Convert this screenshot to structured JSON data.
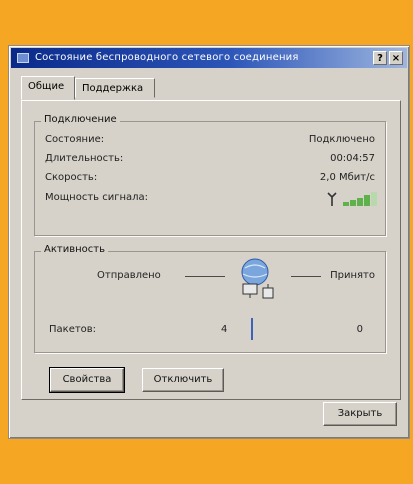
{
  "window": {
    "title": "Состояние беспроводного сетевого соединения",
    "help_label": "?",
    "close_label": "×"
  },
  "tabs": [
    {
      "label": "Общие"
    },
    {
      "label": "Поддержка"
    }
  ],
  "connection": {
    "group_title": "Подключение",
    "rows": [
      {
        "label": "Состояние:",
        "value": "Подключено"
      },
      {
        "label": "Длительность:",
        "value": "00:04:57"
      },
      {
        "label": "Скорость:",
        "value": "2,0 Мбит/с"
      },
      {
        "label": "Мощность сигнала:",
        "value": ""
      }
    ],
    "signal_icon": "signal-strength-icon",
    "signal_level": 0.8
  },
  "activity": {
    "group_title": "Активность",
    "sent_label": "Отправлено",
    "received_label": "Принято",
    "packets_label": "Пакетов:",
    "sent_value": "4",
    "received_value": "0",
    "network_icon": "network-computers-icon"
  },
  "buttons": {
    "properties": "Свойства",
    "disable": "Отключить",
    "close": "Закрыть"
  },
  "colors": {
    "background": "#f5a623",
    "titlebar": "#0a2a8a",
    "signal": "#5fb24b"
  }
}
